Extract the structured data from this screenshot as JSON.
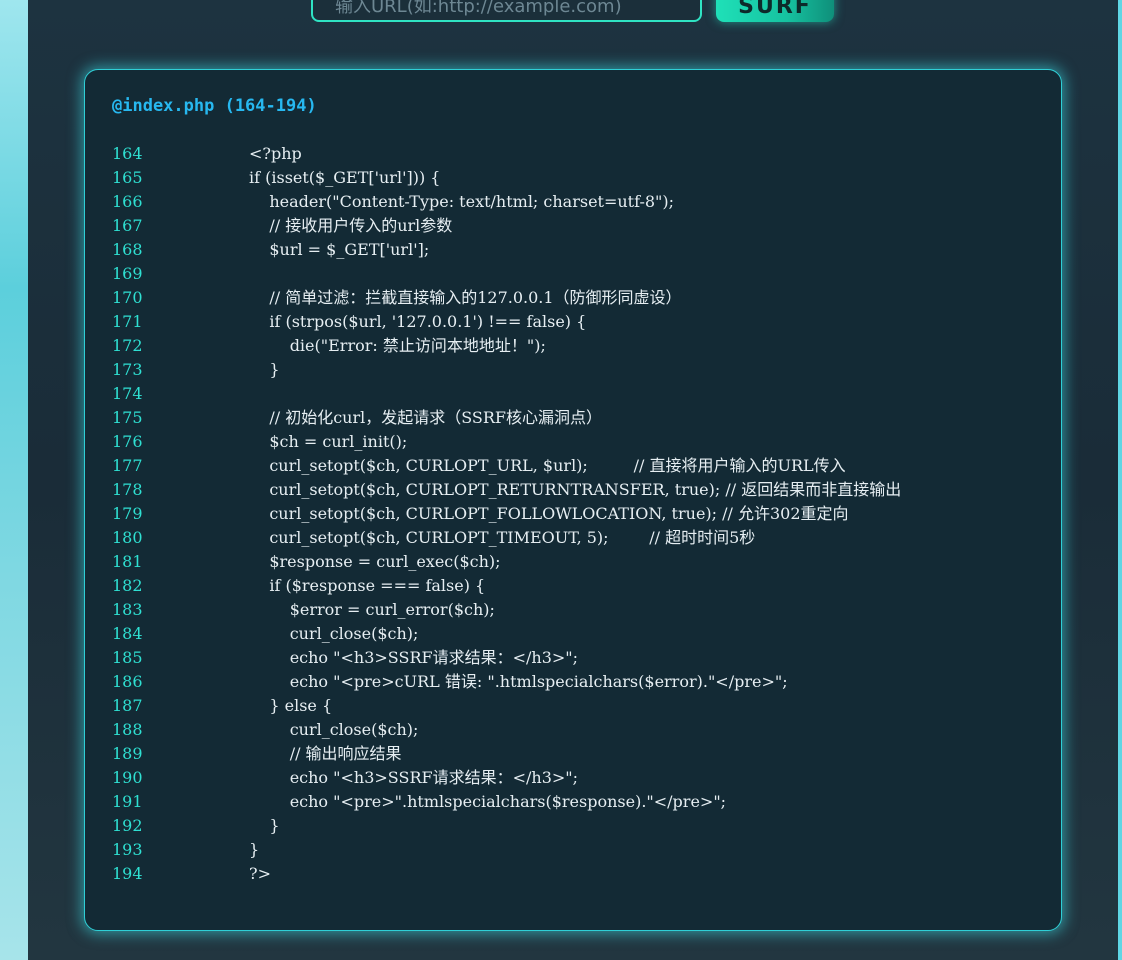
{
  "url_form": {
    "placeholder": "输入URL(如:http://example.com)",
    "submit_label": "SURF"
  },
  "code_view": {
    "title": "@index.php (164-194)",
    "lines": [
      {
        "no": "164",
        "code": "<?php"
      },
      {
        "no": "165",
        "code": "if (isset($_GET['url'])) {"
      },
      {
        "no": "166",
        "code": "    header(\"Content-Type: text/html; charset=utf-8\");"
      },
      {
        "no": "167",
        "code": "    // 接收用户传入的url参数"
      },
      {
        "no": "168",
        "code": "    $url = $_GET['url'];"
      },
      {
        "no": "169",
        "code": ""
      },
      {
        "no": "170",
        "code": "    // 简单过滤：拦截直接输入的127.0.0.1（防御形同虚设）"
      },
      {
        "no": "171",
        "code": "    if (strpos($url, '127.0.0.1') !== false) {"
      },
      {
        "no": "172",
        "code": "        die(\"Error: 禁止访问本地地址！\");"
      },
      {
        "no": "173",
        "code": "    }"
      },
      {
        "no": "174",
        "code": ""
      },
      {
        "no": "175",
        "code": "    // 初始化curl，发起请求（SSRF核心漏洞点）"
      },
      {
        "no": "176",
        "code": "    $ch = curl_init();"
      },
      {
        "no": "177",
        "code": "    curl_setopt($ch, CURLOPT_URL, $url);         // 直接将用户输入的URL传入"
      },
      {
        "no": "178",
        "code": "    curl_setopt($ch, CURLOPT_RETURNTRANSFER, true); // 返回结果而非直接输出"
      },
      {
        "no": "179",
        "code": "    curl_setopt($ch, CURLOPT_FOLLOWLOCATION, true); // 允许302重定向"
      },
      {
        "no": "180",
        "code": "    curl_setopt($ch, CURLOPT_TIMEOUT, 5);        // 超时时间5秒"
      },
      {
        "no": "181",
        "code": "    $response = curl_exec($ch);"
      },
      {
        "no": "182",
        "code": "    if ($response === false) {"
      },
      {
        "no": "183",
        "code": "        $error = curl_error($ch);"
      },
      {
        "no": "184",
        "code": "        curl_close($ch);"
      },
      {
        "no": "185",
        "code": "        echo \"<h3>SSRF请求结果：</h3>\";"
      },
      {
        "no": "186",
        "code": "        echo \"<pre>cURL 错误: \".htmlspecialchars($error).\"</pre>\";"
      },
      {
        "no": "187",
        "code": "    } else {"
      },
      {
        "no": "188",
        "code": "        curl_close($ch);"
      },
      {
        "no": "189",
        "code": "        // 输出响应结果"
      },
      {
        "no": "190",
        "code": "        echo \"<h3>SSRF请求结果：</h3>\";"
      },
      {
        "no": "191",
        "code": "        echo \"<pre>\".htmlspecialchars($response).\"</pre>\";"
      },
      {
        "no": "192",
        "code": "    }"
      },
      {
        "no": "193",
        "code": "}"
      },
      {
        "no": "194",
        "code": "?>"
      }
    ]
  },
  "colors": {
    "accent": "#2fe3c3",
    "title_blue": "#27b8f0",
    "line_number": "#2fe0d2",
    "code_text": "#e6eef2",
    "card_background": "#132a35"
  }
}
